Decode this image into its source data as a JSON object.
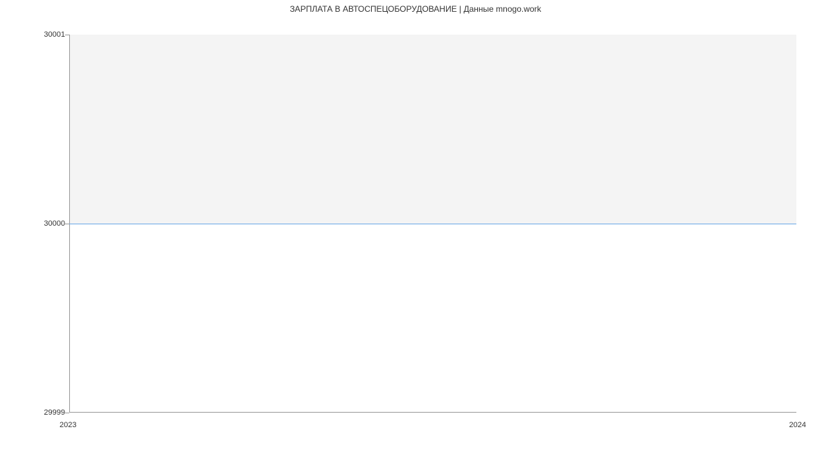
{
  "chart_data": {
    "type": "line",
    "title": "ЗАРПЛАТА В АВТОСПЕЦОБОРУДОВАНИЕ | Данные mnogo.work",
    "x": [
      2023,
      2024
    ],
    "values": [
      30000,
      30000
    ],
    "xlabel": "",
    "ylabel": "",
    "ylim": [
      29999,
      30001
    ],
    "xlim": [
      2023,
      2024
    ],
    "y_ticks": [
      29999,
      30000,
      30001
    ],
    "x_ticks": [
      2023,
      2024
    ]
  }
}
